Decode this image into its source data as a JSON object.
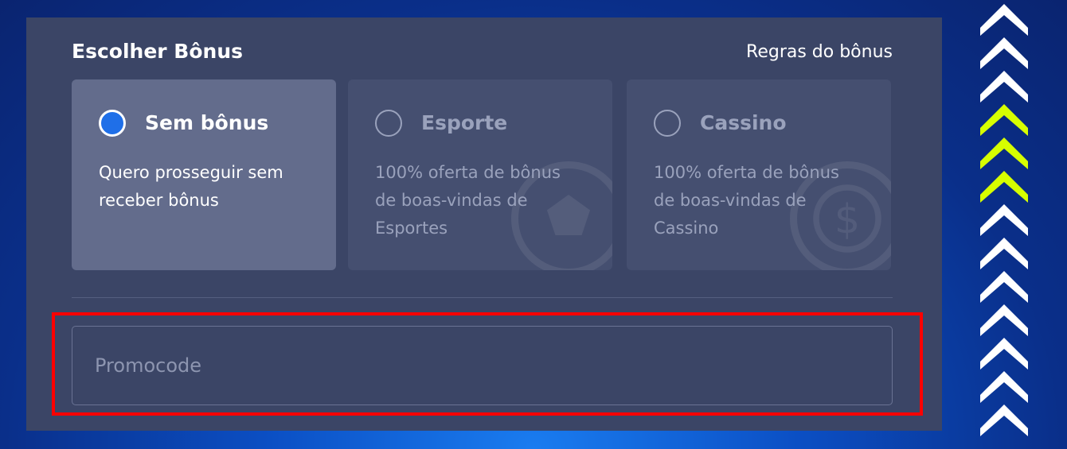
{
  "bonus": {
    "title": "Escolher Bônus",
    "rules_link": "Regras do bônus",
    "options": [
      {
        "label": "Sem bônus",
        "description": "Quero prosseguir sem receber bônus",
        "selected": true
      },
      {
        "label": "Esporte",
        "description": "100% oferta de bônus de boas-vindas de Esportes",
        "selected": false
      },
      {
        "label": "Cassino",
        "description": "100% oferta de bônus de boas-vindas de Cassino",
        "selected": false
      }
    ]
  },
  "promo": {
    "placeholder": "Promocode",
    "value": ""
  },
  "colors": {
    "panel": "#3b4566",
    "selected_card": "#636c8c",
    "radio_selected": "#1f6fe8",
    "highlight": "#ff0000",
    "chevron_white": "#ffffff",
    "chevron_accent": "#d7ff00"
  }
}
